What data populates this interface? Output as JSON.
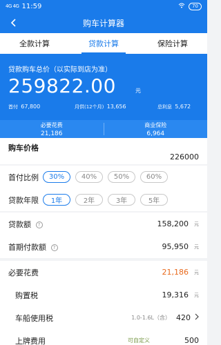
{
  "status": {
    "signal": "4G 4G",
    "time": "11:59",
    "battery": "70"
  },
  "nav": {
    "title": "购车计算器"
  },
  "tabs": [
    {
      "label": "全款计算"
    },
    {
      "label": "贷款计算"
    },
    {
      "label": "保险计算"
    }
  ],
  "summary": {
    "caption": "贷款购车总价（以实际到店为准）",
    "total": "259822.00",
    "total_unit": "元",
    "down_payment_label": "首付",
    "down_payment": "67,800",
    "monthly_label": "月供(12个月)",
    "monthly": "13,656",
    "interest_label": "总利息",
    "interest": "5,672",
    "required_label": "必要花费",
    "required": "21,186",
    "insurance_label": "商业保险",
    "insurance": "6,964"
  },
  "price": {
    "label": "购车价格",
    "value": "226000"
  },
  "down_ratio": {
    "label": "首付比例",
    "options": [
      "30%",
      "40%",
      "50%",
      "60%"
    ],
    "selected": "30%"
  },
  "loan_years": {
    "label": "贷款年限",
    "options": [
      "1年",
      "2年",
      "3年",
      "5年"
    ],
    "selected": "1年"
  },
  "loan_amount": {
    "label": "贷款额",
    "value": "158,200",
    "unit": "元"
  },
  "first_payment": {
    "label": "首期付款额",
    "value": "95,950",
    "unit": "元"
  },
  "required_costs": {
    "label": "必要花费",
    "value": "21,186",
    "unit": "元"
  },
  "purchase_tax": {
    "label": "购置税",
    "value": "19,316",
    "unit": "元"
  },
  "vehicle_tax": {
    "label": "车船使用税",
    "sub": "1.0-1.6L（含）",
    "value": "420"
  },
  "plate_fee": {
    "label": "上牌费用",
    "hint": "可自定义",
    "value": "500"
  },
  "colors": {
    "primary": "#1a7bea",
    "accent": "#e8691c"
  }
}
